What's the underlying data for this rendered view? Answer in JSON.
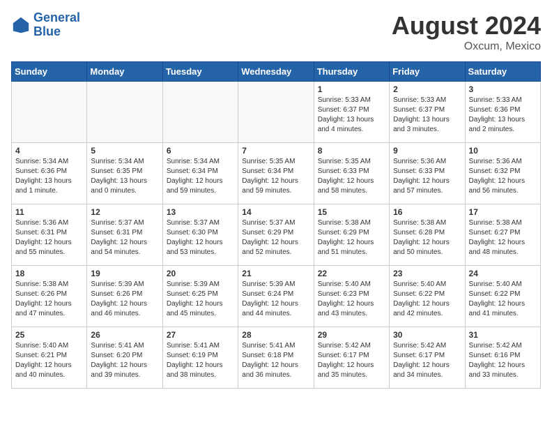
{
  "header": {
    "logo_line1": "General",
    "logo_line2": "Blue",
    "month_year": "August 2024",
    "location": "Oxcum, Mexico"
  },
  "days_of_week": [
    "Sunday",
    "Monday",
    "Tuesday",
    "Wednesday",
    "Thursday",
    "Friday",
    "Saturday"
  ],
  "weeks": [
    [
      {
        "num": "",
        "info": ""
      },
      {
        "num": "",
        "info": ""
      },
      {
        "num": "",
        "info": ""
      },
      {
        "num": "",
        "info": ""
      },
      {
        "num": "1",
        "info": "Sunrise: 5:33 AM\nSunset: 6:37 PM\nDaylight: 13 hours\nand 4 minutes."
      },
      {
        "num": "2",
        "info": "Sunrise: 5:33 AM\nSunset: 6:37 PM\nDaylight: 13 hours\nand 3 minutes."
      },
      {
        "num": "3",
        "info": "Sunrise: 5:33 AM\nSunset: 6:36 PM\nDaylight: 13 hours\nand 2 minutes."
      }
    ],
    [
      {
        "num": "4",
        "info": "Sunrise: 5:34 AM\nSunset: 6:36 PM\nDaylight: 13 hours\nand 1 minute."
      },
      {
        "num": "5",
        "info": "Sunrise: 5:34 AM\nSunset: 6:35 PM\nDaylight: 13 hours\nand 0 minutes."
      },
      {
        "num": "6",
        "info": "Sunrise: 5:34 AM\nSunset: 6:34 PM\nDaylight: 12 hours\nand 59 minutes."
      },
      {
        "num": "7",
        "info": "Sunrise: 5:35 AM\nSunset: 6:34 PM\nDaylight: 12 hours\nand 59 minutes."
      },
      {
        "num": "8",
        "info": "Sunrise: 5:35 AM\nSunset: 6:33 PM\nDaylight: 12 hours\nand 58 minutes."
      },
      {
        "num": "9",
        "info": "Sunrise: 5:36 AM\nSunset: 6:33 PM\nDaylight: 12 hours\nand 57 minutes."
      },
      {
        "num": "10",
        "info": "Sunrise: 5:36 AM\nSunset: 6:32 PM\nDaylight: 12 hours\nand 56 minutes."
      }
    ],
    [
      {
        "num": "11",
        "info": "Sunrise: 5:36 AM\nSunset: 6:31 PM\nDaylight: 12 hours\nand 55 minutes."
      },
      {
        "num": "12",
        "info": "Sunrise: 5:37 AM\nSunset: 6:31 PM\nDaylight: 12 hours\nand 54 minutes."
      },
      {
        "num": "13",
        "info": "Sunrise: 5:37 AM\nSunset: 6:30 PM\nDaylight: 12 hours\nand 53 minutes."
      },
      {
        "num": "14",
        "info": "Sunrise: 5:37 AM\nSunset: 6:29 PM\nDaylight: 12 hours\nand 52 minutes."
      },
      {
        "num": "15",
        "info": "Sunrise: 5:38 AM\nSunset: 6:29 PM\nDaylight: 12 hours\nand 51 minutes."
      },
      {
        "num": "16",
        "info": "Sunrise: 5:38 AM\nSunset: 6:28 PM\nDaylight: 12 hours\nand 50 minutes."
      },
      {
        "num": "17",
        "info": "Sunrise: 5:38 AM\nSunset: 6:27 PM\nDaylight: 12 hours\nand 48 minutes."
      }
    ],
    [
      {
        "num": "18",
        "info": "Sunrise: 5:38 AM\nSunset: 6:26 PM\nDaylight: 12 hours\nand 47 minutes."
      },
      {
        "num": "19",
        "info": "Sunrise: 5:39 AM\nSunset: 6:26 PM\nDaylight: 12 hours\nand 46 minutes."
      },
      {
        "num": "20",
        "info": "Sunrise: 5:39 AM\nSunset: 6:25 PM\nDaylight: 12 hours\nand 45 minutes."
      },
      {
        "num": "21",
        "info": "Sunrise: 5:39 AM\nSunset: 6:24 PM\nDaylight: 12 hours\nand 44 minutes."
      },
      {
        "num": "22",
        "info": "Sunrise: 5:40 AM\nSunset: 6:23 PM\nDaylight: 12 hours\nand 43 minutes."
      },
      {
        "num": "23",
        "info": "Sunrise: 5:40 AM\nSunset: 6:22 PM\nDaylight: 12 hours\nand 42 minutes."
      },
      {
        "num": "24",
        "info": "Sunrise: 5:40 AM\nSunset: 6:22 PM\nDaylight: 12 hours\nand 41 minutes."
      }
    ],
    [
      {
        "num": "25",
        "info": "Sunrise: 5:40 AM\nSunset: 6:21 PM\nDaylight: 12 hours\nand 40 minutes."
      },
      {
        "num": "26",
        "info": "Sunrise: 5:41 AM\nSunset: 6:20 PM\nDaylight: 12 hours\nand 39 minutes."
      },
      {
        "num": "27",
        "info": "Sunrise: 5:41 AM\nSunset: 6:19 PM\nDaylight: 12 hours\nand 38 minutes."
      },
      {
        "num": "28",
        "info": "Sunrise: 5:41 AM\nSunset: 6:18 PM\nDaylight: 12 hours\nand 36 minutes."
      },
      {
        "num": "29",
        "info": "Sunrise: 5:42 AM\nSunset: 6:17 PM\nDaylight: 12 hours\nand 35 minutes."
      },
      {
        "num": "30",
        "info": "Sunrise: 5:42 AM\nSunset: 6:17 PM\nDaylight: 12 hours\nand 34 minutes."
      },
      {
        "num": "31",
        "info": "Sunrise: 5:42 AM\nSunset: 6:16 PM\nDaylight: 12 hours\nand 33 minutes."
      }
    ]
  ]
}
